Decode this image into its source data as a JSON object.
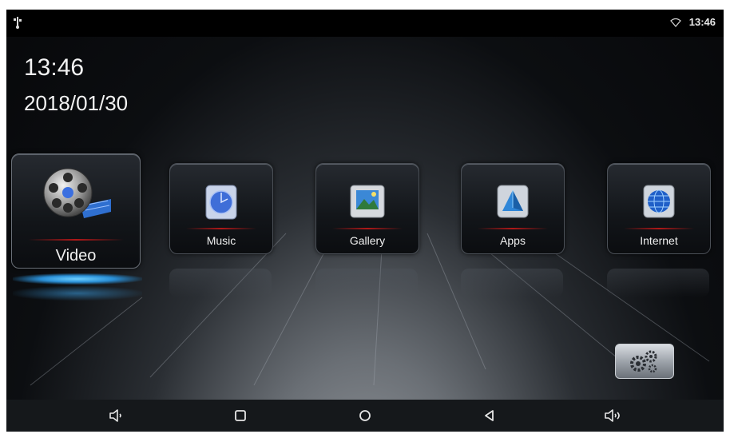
{
  "status_bar": {
    "left_icon": "usb-icon",
    "wifi_icon": "wifi-icon",
    "time": "13:46"
  },
  "clock": {
    "time": "13:46",
    "date": "2018/01/30"
  },
  "apps": [
    {
      "label": "Video",
      "icon": "film-reel-icon",
      "selected": true
    },
    {
      "label": "Music",
      "icon": "music-disc-icon",
      "selected": false
    },
    {
      "label": "Gallery",
      "icon": "gallery-photo-icon",
      "selected": false
    },
    {
      "label": "Apps",
      "icon": "pyramid-icon",
      "selected": false
    },
    {
      "label": "Internet",
      "icon": "globe-icon",
      "selected": false
    }
  ],
  "settings_button": {
    "icon": "gears-icon"
  },
  "nav_bar": [
    {
      "name": "volume-down",
      "icon": "volume-down-icon"
    },
    {
      "name": "recents",
      "icon": "recents-square-icon"
    },
    {
      "name": "home",
      "icon": "home-circle-icon"
    },
    {
      "name": "back",
      "icon": "back-triangle-icon"
    },
    {
      "name": "volume-up",
      "icon": "volume-up-icon"
    }
  ],
  "colors": {
    "accent_glow": "#2a8fd6",
    "tile_redline": "#b01818",
    "navbar_bg": "#15181b"
  }
}
